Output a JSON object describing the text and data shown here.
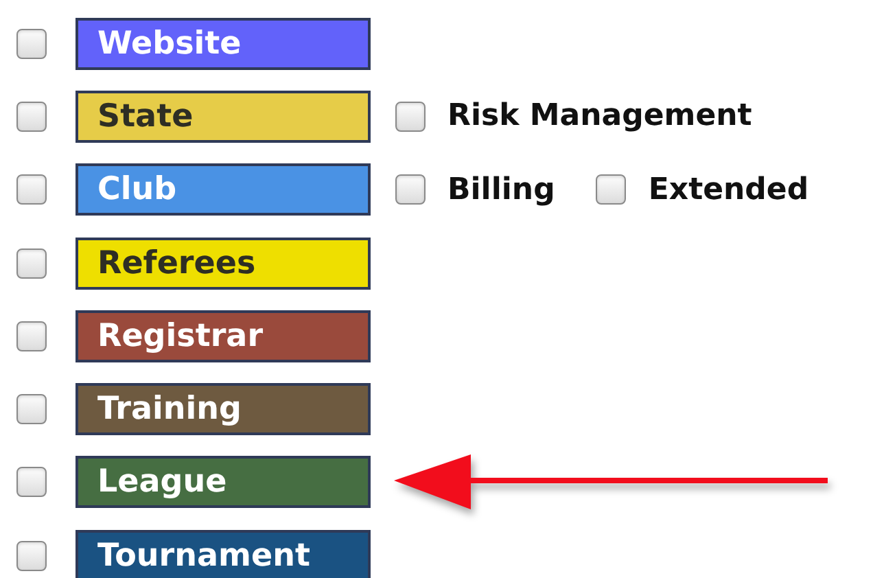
{
  "roles": [
    {
      "label": "Website",
      "color": "#6262fa",
      "checked": false,
      "pointed": false
    },
    {
      "label": "State",
      "color": "#e6cc48",
      "checked": false,
      "pointed": false,
      "options": [
        {
          "label": "Risk Management",
          "checked": false
        }
      ]
    },
    {
      "label": "Club",
      "color": "#4a92e4",
      "checked": false,
      "pointed": false,
      "options": [
        {
          "label": "Billing",
          "checked": false
        },
        {
          "label": "Extended",
          "checked": false
        }
      ]
    },
    {
      "label": "Referees",
      "color": "#eedf00",
      "checked": false,
      "pointed": false
    },
    {
      "label": "Registrar",
      "color": "#9a4a3c",
      "checked": false,
      "pointed": false
    },
    {
      "label": "Training",
      "color": "#6e5a40",
      "checked": false,
      "pointed": false
    },
    {
      "label": "League",
      "color": "#466e42",
      "checked": false,
      "pointed": true
    },
    {
      "label": "Tournament",
      "color": "#1a5282",
      "checked": false,
      "pointed": false
    }
  ]
}
